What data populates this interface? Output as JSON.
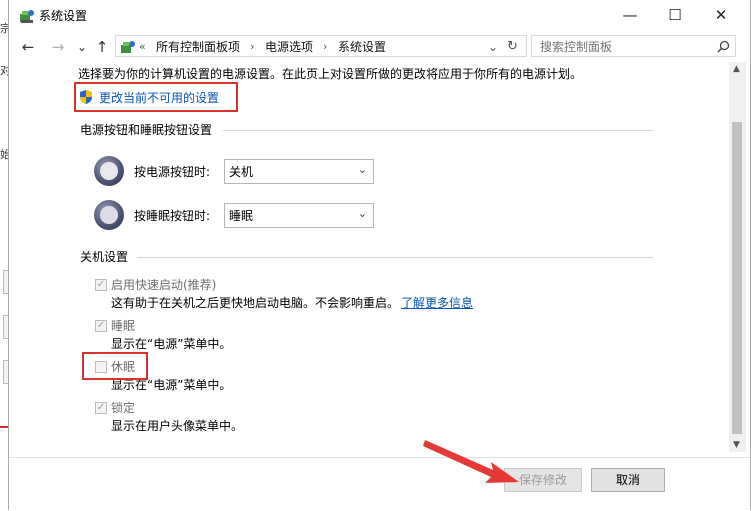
{
  "window": {
    "title": "系统设置",
    "controls": {
      "minimize": "—",
      "maximize": "☐",
      "close": "✕"
    }
  },
  "nav": {
    "back": "←",
    "forward": "→",
    "recent": "⌄",
    "up": "↑",
    "refresh": "↻"
  },
  "address": {
    "overflow": "«",
    "crumbs": [
      "所有控制面板项",
      "电源选项",
      "系统设置"
    ],
    "separator": "›",
    "dropdown": "⌄"
  },
  "search": {
    "placeholder": "搜索控制面板"
  },
  "intro": {
    "text": "选择要为你的计算机设置的电源设置。在此页上对设置所做的更改将应用于你所有的电源计划。",
    "change_link": "更改当前不可用的设置"
  },
  "buttons_section": {
    "title": "电源按钮和睡眠按钮设置",
    "power_label": "按电源按钮时:",
    "power_value": "关机",
    "sleep_label": "按睡眠按钮时:",
    "sleep_value": "睡眠"
  },
  "shutdown_section": {
    "title": "关机设置",
    "items": [
      {
        "label": "启用快速启动(推荐)",
        "desc": "这有助于在关机之后更快地启动电脑。不会影响重启。",
        "link": "了解更多信息",
        "checked": true
      },
      {
        "label": "睡眠",
        "desc": "显示在“电源”菜单中。",
        "checked": true
      },
      {
        "label": "休眠",
        "desc": "显示在“电源”菜单中。",
        "checked": false
      },
      {
        "label": "锁定",
        "desc": "显示在用户头像菜单中。",
        "checked": true
      }
    ]
  },
  "footer": {
    "save": "保存修改",
    "cancel": "取消"
  },
  "annotation_color": "#d9342b"
}
